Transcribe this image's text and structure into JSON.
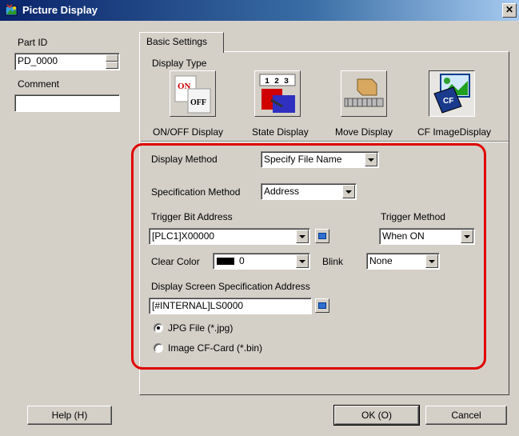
{
  "window": {
    "title": "Picture Display"
  },
  "left": {
    "part_id_label": "Part ID",
    "part_id_value": "PD_0000",
    "comment_label": "Comment",
    "comment_value": ""
  },
  "tab": {
    "label": "Basic Settings"
  },
  "display_type": {
    "label": "Display Type",
    "items": [
      {
        "label": "ON/OFF Display",
        "icon": "on-off-display-icon",
        "selected": false
      },
      {
        "label": "State Display",
        "icon": "state-display-icon",
        "selected": false
      },
      {
        "label": "Move Display",
        "icon": "move-display-icon",
        "selected": false
      },
      {
        "label": "CF ImageDisplay",
        "icon": "cf-image-display-icon",
        "selected": true
      }
    ]
  },
  "settings": {
    "display_method_label": "Display Method",
    "display_method_value": "Specify File Name",
    "spec_method_label": "Specification Method",
    "spec_method_value": "Address",
    "trigger_bit_label": "Trigger Bit Address",
    "trigger_bit_value": "[PLC1]X00000",
    "trigger_method_label": "Trigger Method",
    "trigger_method_value": "When ON",
    "clear_color_label": "Clear Color",
    "clear_color_value": "0",
    "clear_color_swatch": "#000000",
    "blink_label": "Blink",
    "blink_value": "None",
    "screen_addr_label": "Display Screen Specification Address",
    "screen_addr_value": "[#INTERNAL]LS0000",
    "radio_jpg_label": "JPG File (*.jpg)",
    "radio_bin_label": "Image CF-Card (*.bin)",
    "selected_radio": "jpg"
  },
  "buttons": {
    "help": "Help (H)",
    "ok": "OK (O)",
    "cancel": "Cancel"
  },
  "colors": {
    "highlight_frame": "#e00000",
    "title_bar": "#0a246a",
    "dialog": "#d4d0c8"
  }
}
